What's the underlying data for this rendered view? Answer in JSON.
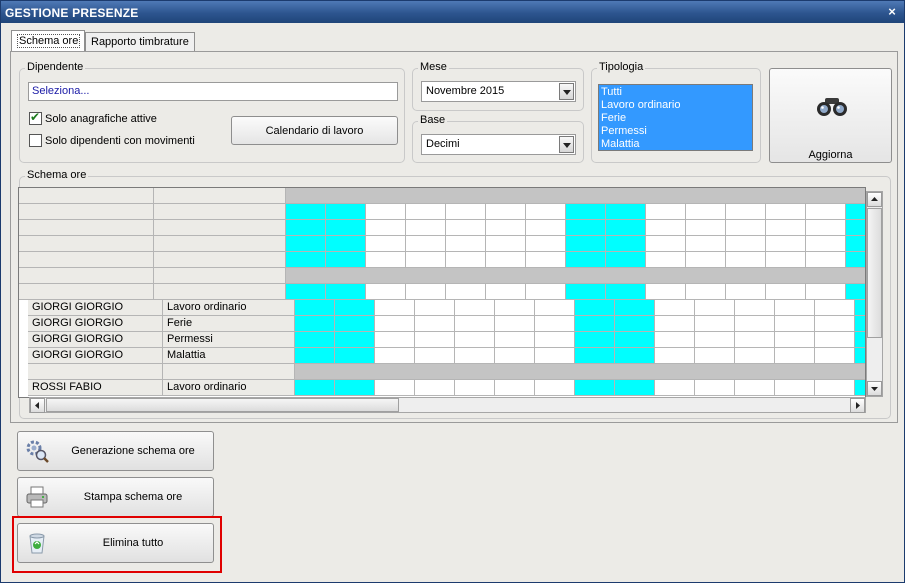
{
  "window": {
    "title": "GESTIONE PRESENZE",
    "close_glyph": "×"
  },
  "tabs": [
    {
      "label": "Schema ore",
      "active": true
    },
    {
      "label": "Rapporto timbrature",
      "active": false
    }
  ],
  "dipendente": {
    "group_label": "Dipendente",
    "value": "Seleziona...",
    "solo_attive_label": "Solo anagrafiche attive",
    "solo_attive_checked": true,
    "solo_movimenti_label": "Solo dipendenti con movimenti",
    "solo_movimenti_checked": false,
    "calendario_button": "Calendario di lavoro"
  },
  "mese": {
    "group_label": "Mese",
    "selected": "Novembre 2015"
  },
  "base": {
    "group_label": "Base",
    "selected": "Decimi"
  },
  "tipologia": {
    "group_label": "Tipologia",
    "items": [
      "Tutti",
      "Lavoro ordinario",
      "Ferie",
      "Permessi",
      "Malattia"
    ]
  },
  "aggiorna": {
    "label": "Aggiorna",
    "icon": "binoculars-icon"
  },
  "schema": {
    "group_label": "Schema ore",
    "rows": [
      {
        "name": "GIORGI GIORGIO",
        "type": "Lavoro ordinario"
      },
      {
        "name": "GIORGI GIORGIO",
        "type": "Ferie"
      },
      {
        "name": "GIORGI GIORGIO",
        "type": "Permessi"
      },
      {
        "name": "GIORGI GIORGIO",
        "type": "Malattia"
      },
      {
        "name": "ROSSI FABIO",
        "type": "Lavoro ordinario"
      }
    ],
    "day_pattern": [
      "weekend",
      "weekend",
      "weekday",
      "weekday",
      "weekday",
      "weekday",
      "weekday",
      "weekend",
      "weekend",
      "weekday",
      "weekday",
      "weekday",
      "weekday",
      "weekday",
      "weekend"
    ]
  },
  "actions": {
    "generazione": {
      "label": "Generazione schema ore",
      "icon": "gears-search-icon"
    },
    "stampa": {
      "label": "Stampa schema ore",
      "icon": "printer-icon"
    },
    "elimina": {
      "label": "Elimina tutto",
      "icon": "recycle-bin-icon"
    }
  },
  "colors": {
    "weekend": "#00ffff",
    "selection": "#3399ff",
    "highlight_border": "#e00000",
    "titlebar": "#2d558f"
  }
}
